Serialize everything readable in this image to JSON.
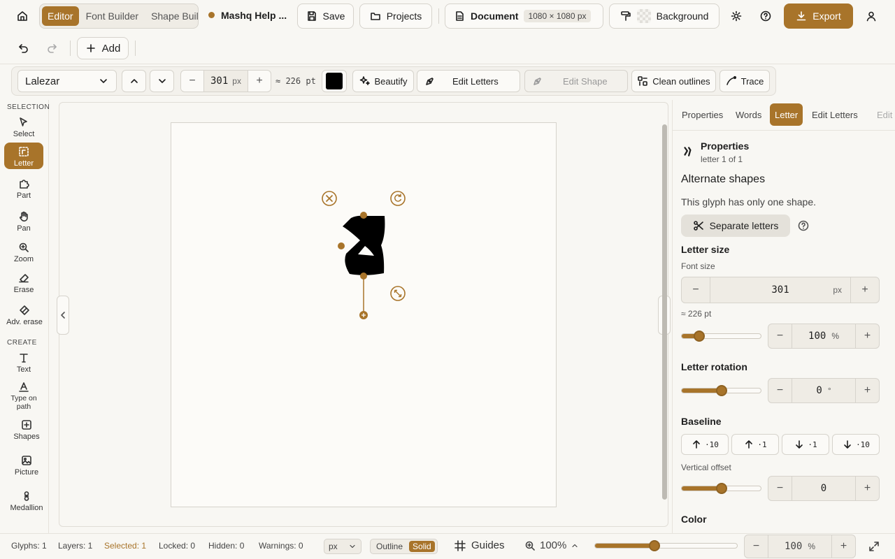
{
  "topbar": {
    "mode_tabs": [
      "Editor",
      "Font Builder",
      "Shape Builder"
    ],
    "project_name": "Mashq Help ...",
    "save_label": "Save",
    "projects_label": "Projects",
    "document_label": "Document",
    "document_size": "1080 × 1080 px",
    "background_label": "Background",
    "export_label": "Export"
  },
  "toolbar2": {
    "add_label": "Add"
  },
  "toolbar3": {
    "font_name": "Lalezar",
    "size_value": "301",
    "size_unit": "px",
    "pt_value": "≈ 226 pt",
    "fill_color": "#000000",
    "beautify_label": "Beautify",
    "edit_letters_label": "Edit Letters",
    "edit_shape_label": "Edit Shape",
    "clean_outlines_label": "Clean outlines",
    "trace_label": "Trace"
  },
  "left_tools": {
    "selection_heading": "SELECTION",
    "create_heading": "CREATE",
    "items": [
      {
        "label": "Select",
        "icon": "pointer-icon"
      },
      {
        "label": "Letter",
        "icon": "letter-select-icon"
      },
      {
        "label": "Part",
        "icon": "puzzle-icon"
      },
      {
        "label": "Pan",
        "icon": "hand-icon"
      },
      {
        "label": "Zoom",
        "icon": "zoom-icon"
      },
      {
        "label": "Erase",
        "icon": "eraser-icon"
      },
      {
        "label": "Adv. erase",
        "icon": "adv-eraser-icon"
      },
      {
        "label": "Text",
        "icon": "text-icon"
      },
      {
        "label": "Type on path",
        "icon": "type-path-icon"
      },
      {
        "label": "Shapes",
        "icon": "shapes-icon"
      },
      {
        "label": "Picture",
        "icon": "picture-icon"
      },
      {
        "label": "Medallion",
        "icon": "medallion-icon"
      }
    ]
  },
  "right_panel": {
    "tabs": [
      "Properties",
      "Words",
      "Letter",
      "Edit Letters",
      "Edit"
    ],
    "properties_title": "Properties",
    "properties_sub": "letter 1 of 1",
    "alternate_heading": "Alternate shapes",
    "alternate_note": "This glyph has only one shape.",
    "separate_label": "Separate letters",
    "letter_size_heading": "Letter size",
    "font_size_label": "Font size",
    "font_size_value": "301",
    "font_size_unit": "px",
    "pt_value": "≈ 226 pt",
    "scale_value": "100",
    "scale_unit": "%",
    "scale_level": 0.22,
    "rotation_heading": "Letter rotation",
    "rotation_value": "0",
    "rotation_unit": "°",
    "rotation_level": 0.5,
    "baseline_heading": "Baseline",
    "baseline_buttons": [
      "·10",
      "·1",
      "·1",
      "·10"
    ],
    "vertical_offset_label": "Vertical offset",
    "vertical_offset_value": "0",
    "vertical_offset_level": 0.5,
    "color_heading": "Color"
  },
  "statusbar": {
    "glyphs": "Glyphs: 1",
    "layers": "Layers: 1",
    "selected": "Selected: 1",
    "locked": "Locked: 0",
    "hidden": "Hidden: 0",
    "warnings": "Warnings: 0",
    "unit": "px",
    "outline_label": "Outline",
    "solid_label": "Solid",
    "guides_label": "Guides",
    "zoom_label": "100%",
    "zoom_level": 0.42,
    "zoom_value": "100",
    "zoom_unit": "%"
  },
  "colors": {
    "accent": "#a8742a",
    "background": "#f8f7f3"
  }
}
